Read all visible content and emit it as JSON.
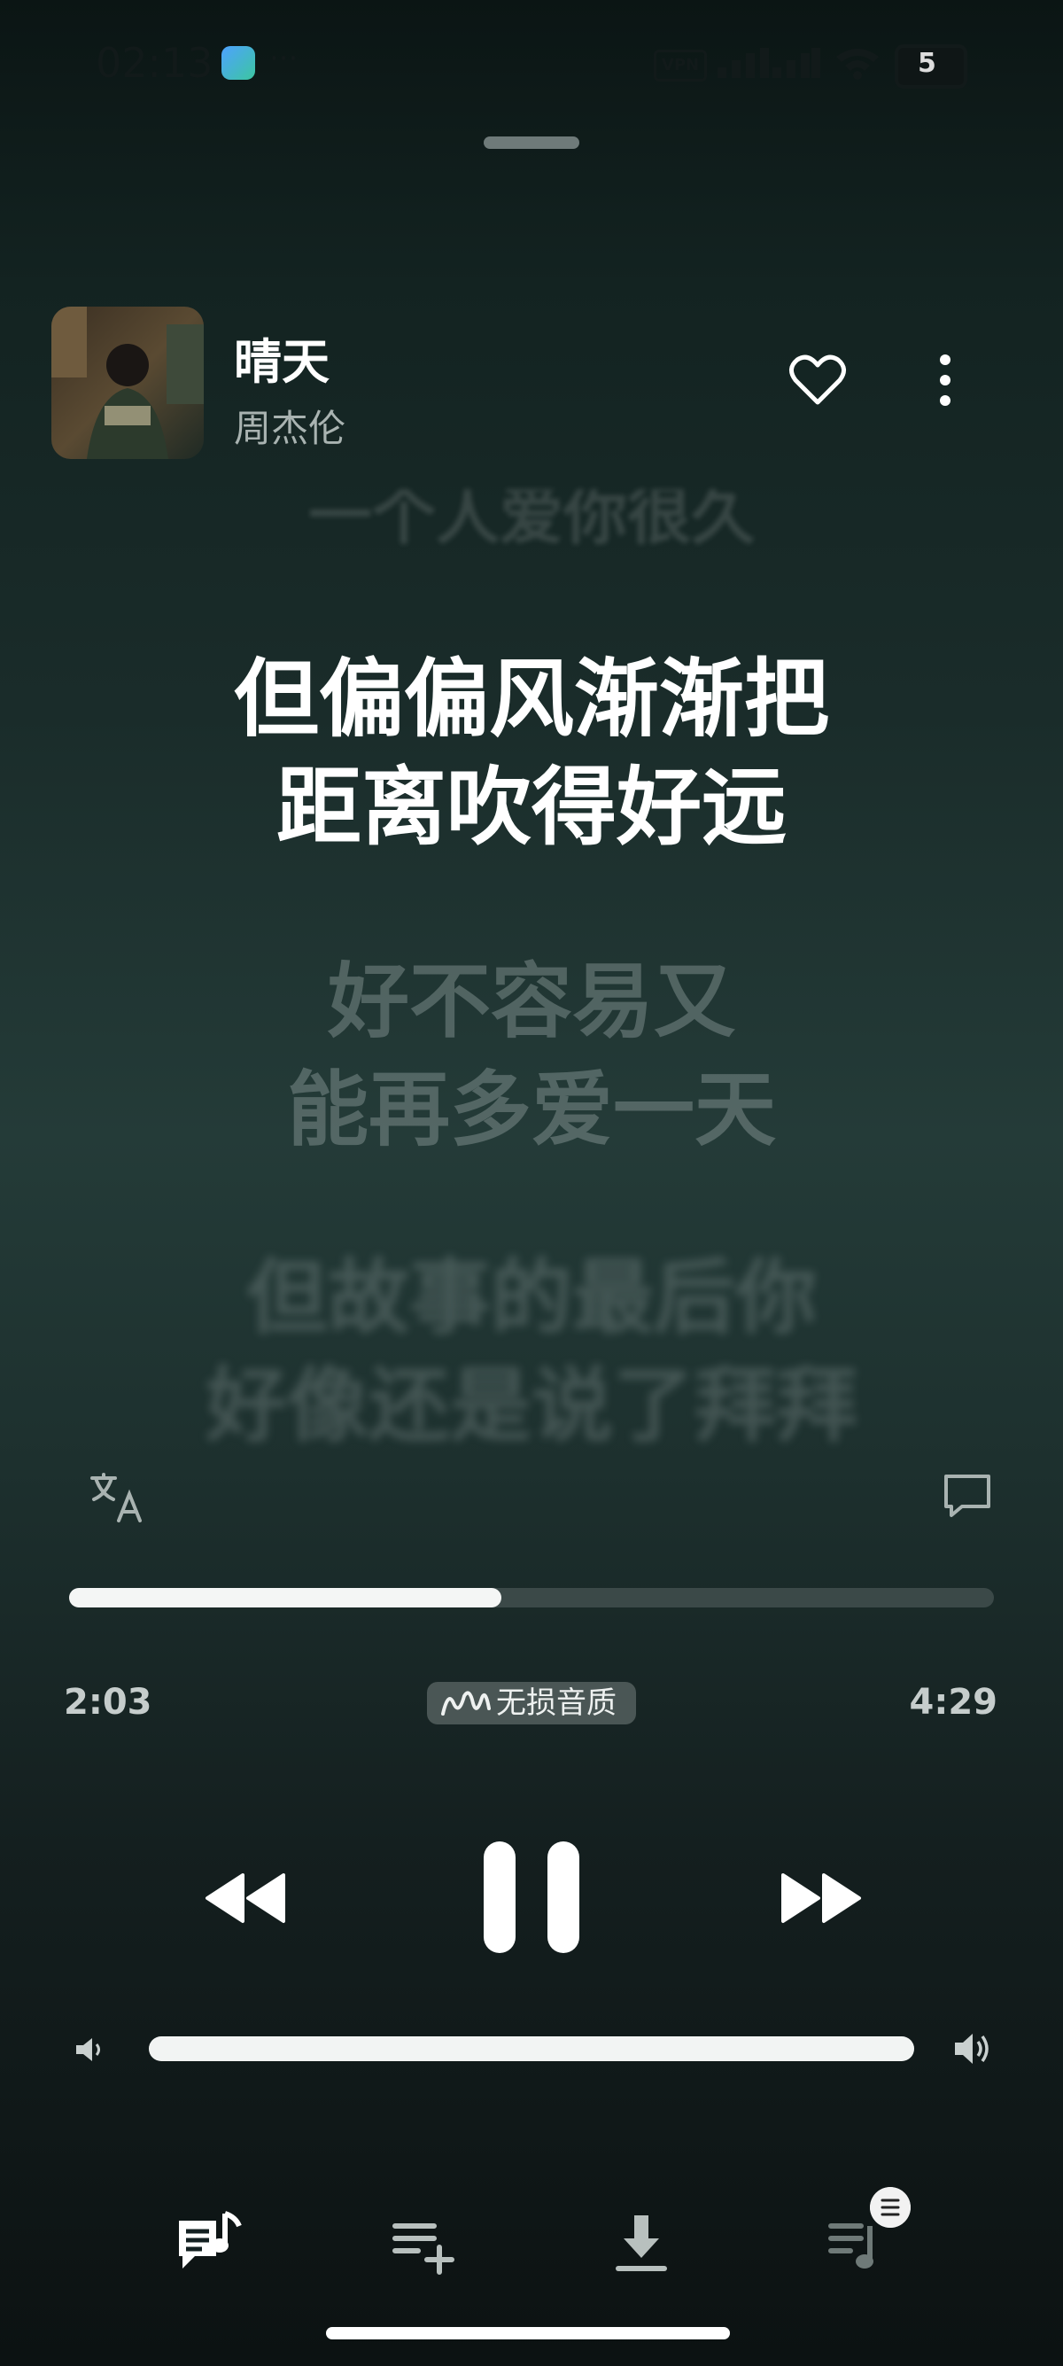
{
  "status_bar": {
    "time": "02:13",
    "more_indicator": "···",
    "vpn_label": "VPN",
    "battery_level": "5"
  },
  "song": {
    "title": "晴天",
    "artist": "周杰伦",
    "liked": false
  },
  "lyrics": {
    "previous": "一个人爱你很久",
    "current_line1": "但偏偏风渐渐把",
    "current_line2": "距离吹得好远",
    "next_line1": "好不容易又",
    "next_line2": "能再多爱一天",
    "after_line1": "但故事的最后你",
    "after_line2": "好像还是说了拜拜"
  },
  "player": {
    "current_time": "2:03",
    "total_time": "4:29",
    "progress_fraction": 0.467,
    "quality_label": "无损音质",
    "state": "playing"
  },
  "volume": {
    "level_fraction": 1.0
  },
  "icons": {
    "translate": "translate-icon",
    "comment": "comment-icon",
    "prev": "rewind-icon",
    "pause": "pause-icon",
    "next": "fast-forward-icon",
    "nav": [
      "lyrics-icon",
      "add-to-playlist-icon",
      "download-icon",
      "queue-icon"
    ]
  },
  "colors": {
    "accent": "#f4f6f5",
    "track": "#3b4948",
    "muted_text": "#a9b3b1"
  }
}
